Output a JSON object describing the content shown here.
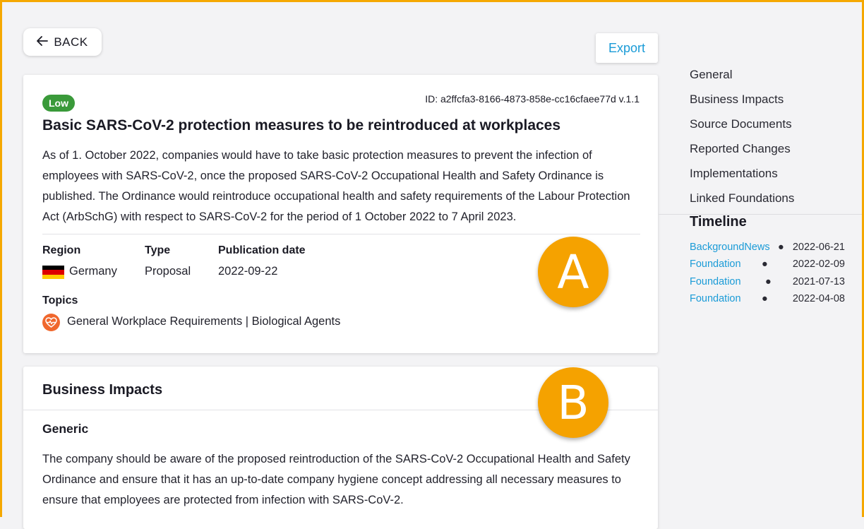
{
  "toolbar": {
    "back_label": "BACK",
    "export_label": "Export"
  },
  "item": {
    "badge": "Low",
    "id_text": "ID: a2ffcfa3-8166-4873-858e-cc16cfaee77d v.1.1",
    "title": "Basic SARS-CoV-2 protection measures to be reintroduced at workplaces",
    "summary": "As of 1. October 2022, companies would have to take basic protection measures to prevent the infection of employees with SARS-CoV-2, once the proposed SARS-CoV-2 Occupational Health and Safety Ordinance is published. The Ordinance would reintroduce occupational health and safety requirements of the Labour Protection Act (ArbSchG) with respect to SARS-CoV-2 for the period of 1 October 2022 to 7 April 2023.",
    "region_label": "Region",
    "region_value": "Germany",
    "type_label": "Type",
    "type_value": "Proposal",
    "pubdate_label": "Publication date",
    "pubdate_value": "2022-09-22",
    "topics_label": "Topics",
    "topics_value": "General Workplace Requirements | Biological Agents"
  },
  "impacts": {
    "title": "Business Impacts",
    "subtitle": "Generic",
    "text": "The company should be aware of the proposed reintroduction of the SARS-CoV-2 Occupational Health and Safety Ordinance and ensure that it has an up-to-date company hygiene concept addressing all necessary measures to ensure that employees are protected from infection with SARS-CoV-2."
  },
  "markers": {
    "a": "A",
    "b": "B"
  },
  "nav": {
    "items": [
      {
        "label": "General"
      },
      {
        "label": "Business Impacts"
      },
      {
        "label": "Source Documents"
      },
      {
        "label": "Reported Changes"
      },
      {
        "label": "Implementations"
      },
      {
        "label": "Linked Foundations"
      }
    ]
  },
  "timeline": {
    "title": "Timeline",
    "entries": [
      {
        "label": "BackgroundNews",
        "date": "2022-06-21"
      },
      {
        "label": "Foundation",
        "date": "2022-02-09"
      },
      {
        "label": "Foundation",
        "date": "2021-07-13"
      },
      {
        "label": "Foundation",
        "date": "2022-04-08"
      }
    ]
  },
  "colors": {
    "accent": "#1a9bd7",
    "badge_low": "#3a9a3a",
    "marker": "#f5a200",
    "topic_icon": "#f0672d",
    "frame": "#f5a800"
  },
  "icons": {
    "back": "arrow-left-icon",
    "flag": "germany-flag-icon",
    "topic": "heart-pulse-icon"
  }
}
